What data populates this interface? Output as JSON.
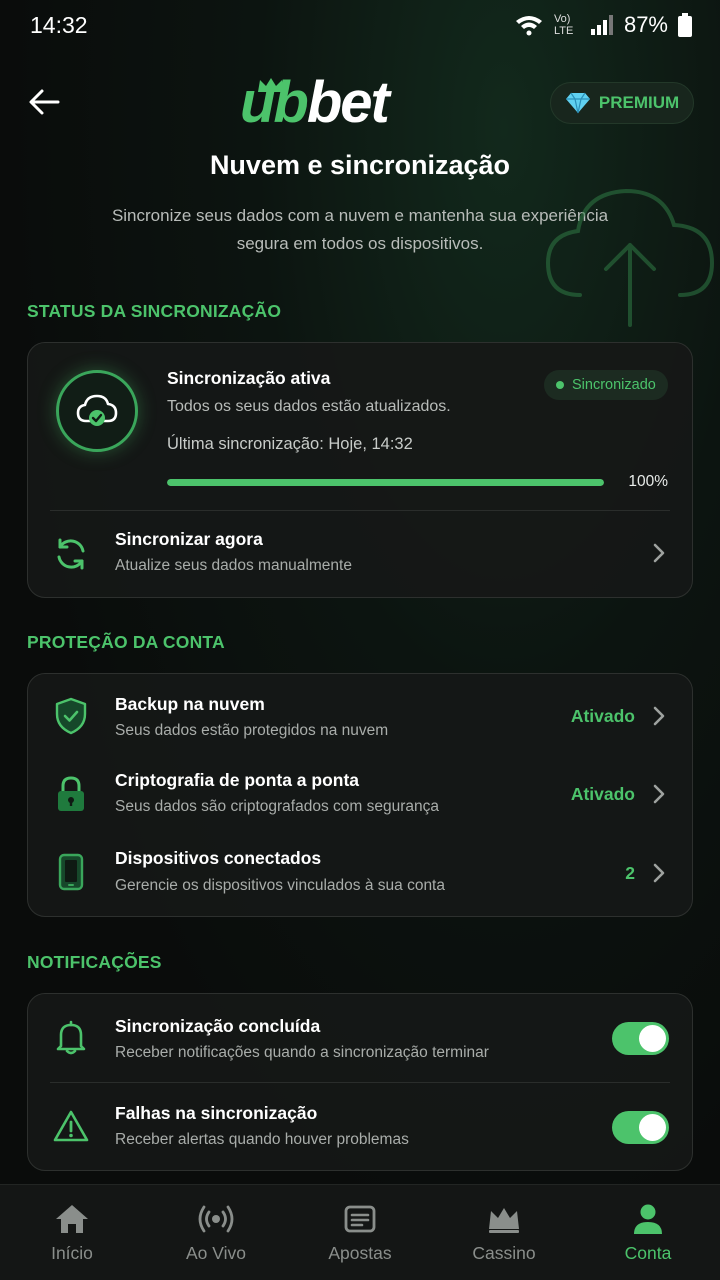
{
  "status_bar": {
    "time": "14:32",
    "network": "Vo) LTE",
    "battery": "87%"
  },
  "header": {
    "logo_ub": "ub",
    "logo_bet": "bet",
    "premium_label": "PREMIUM",
    "title": "Nuvem e sincronização",
    "subtitle": "Sincronize seus dados com a nuvem e mantenha sua experiência segura em todos os dispositivos."
  },
  "sync_section": {
    "label": "STATUS DA SINCRONIZAÇÃO",
    "title": "Sincronização ativa",
    "description": "Todos os seus dados estão atualizados.",
    "last_sync": "Última sincronização: Hoje, 14:32",
    "badge": "Sincronizado",
    "progress": 100,
    "progress_label": "100%",
    "sync_now_title": "Sincronizar agora",
    "sync_now_desc": "Atualize seus dados manualmente"
  },
  "protection_section": {
    "label": "PROTEÇÃO DA CONTA",
    "items": [
      {
        "title": "Backup na nuvem",
        "desc": "Seus dados estão protegidos na nuvem",
        "value": "Ativado",
        "icon": "shield-check-icon"
      },
      {
        "title": "Criptografia de ponta a ponta",
        "desc": "Seus dados são criptografados com segurança",
        "value": "Ativado",
        "icon": "lock-icon"
      },
      {
        "title": "Dispositivos conectados",
        "desc": "Gerencie os dispositivos vinculados à sua conta",
        "value": "2",
        "icon": "phone-icon"
      }
    ]
  },
  "notifications_section": {
    "label": "NOTIFICAÇÕES",
    "items": [
      {
        "title": "Sincronização concluída",
        "desc": "Receber notificações quando a sincronização terminar",
        "enabled": true,
        "icon": "bell-icon"
      },
      {
        "title": "Falhas na sincronização",
        "desc": "Receber alertas quando houver problemas",
        "enabled": true,
        "icon": "warning-icon"
      }
    ]
  },
  "bottom_nav": [
    {
      "label": "Início",
      "icon": "home-icon",
      "active": false
    },
    {
      "label": "Ao Vivo",
      "icon": "live-icon",
      "active": false
    },
    {
      "label": "Apostas",
      "icon": "bets-icon",
      "active": false
    },
    {
      "label": "Cassino",
      "icon": "crown-icon",
      "active": false
    },
    {
      "label": "Conta",
      "icon": "user-icon",
      "active": true
    }
  ],
  "colors": {
    "accent": "#4cc36b",
    "background": "#0a0c0b",
    "card": "#161817",
    "muted_text": "#a9adaa"
  }
}
